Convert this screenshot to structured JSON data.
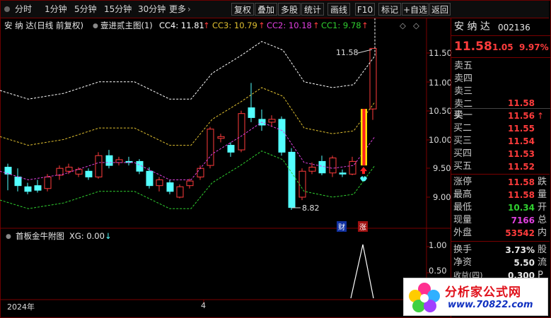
{
  "toolbar": {
    "timeframes": [
      "分时",
      "1分钟",
      "5分钟",
      "15分钟",
      "30分钟",
      "更多"
    ],
    "more_arrow": "›",
    "buttons": [
      "复权",
      "叠加",
      "多股",
      "统计",
      "画线",
      "F10",
      "标记",
      "+自选",
      "返回"
    ]
  },
  "chart": {
    "stock_title": "安 纳 达(日线 前复权)",
    "indicator": "壹进贰主图(1)",
    "cc4": "CC4: 11.81",
    "cc3": "CC3: 10.79",
    "cc2": "CC2: 10.18",
    "cc1": "CC1: 9.78",
    "arrow_up": "↑",
    "diamond": "◇",
    "y_ticks": [
      "11.50",
      "11.00",
      "10.50",
      "10.00",
      "9.50",
      "9.00"
    ],
    "high_label": "11.58",
    "low_label": "8.82",
    "tag_cai": "财",
    "tag_zhang": "涨",
    "x_labels": [
      "2024年",
      "4"
    ],
    "colors": {
      "up": "#ff3c3c",
      "down": "#54ffff",
      "cc4": "#ffffff",
      "cc3": "#e0c030",
      "cc2": "#e040e0",
      "cc1": "#30d030"
    }
  },
  "sub_chart": {
    "indicator": "首板金牛附图",
    "xg": "XG: 0.00",
    "xg_arrow": "↓",
    "y_ticks": [
      "1.00",
      "0.50"
    ]
  },
  "panel": {
    "name": "安 纳 达",
    "code": "002136",
    "price": "11.58",
    "change": "1.05",
    "pct": "9.97%",
    "sell": [
      {
        "label": "卖五",
        "price": ""
      },
      {
        "label": "卖四",
        "price": ""
      },
      {
        "label": "卖三",
        "price": ""
      },
      {
        "label": "卖二",
        "price": ""
      },
      {
        "label": "卖一",
        "price": "11.58"
      }
    ],
    "buy": [
      {
        "label": "买一",
        "price": "11.56"
      },
      {
        "label": "买二",
        "price": "11.55"
      },
      {
        "label": "买三",
        "price": "11.54"
      },
      {
        "label": "买四",
        "price": "11.53"
      },
      {
        "label": "买五",
        "price": "11.52"
      }
    ],
    "buy1_mark": "↑",
    "stats": [
      {
        "label": "涨停",
        "value": "11.58",
        "suffix": "跌"
      },
      {
        "label": "最高",
        "value": "11.58",
        "suffix": "量"
      },
      {
        "label": "最低",
        "value": "10.34",
        "suffix": "开"
      },
      {
        "label": "现量",
        "value": "7166",
        "suffix": "总"
      },
      {
        "label": "外盘",
        "value": "53542",
        "suffix": "内"
      }
    ],
    "stats2": [
      {
        "label": "换手",
        "value": "3.73%",
        "suffix": "股"
      },
      {
        "label": "净资",
        "value": "5.50",
        "suffix": "流"
      },
      {
        "label": "收益(四)",
        "value": "0.300",
        "suffix": "P"
      }
    ]
  },
  "watermark": {
    "title": "分析家公式网",
    "url": "www.70822.com"
  }
}
